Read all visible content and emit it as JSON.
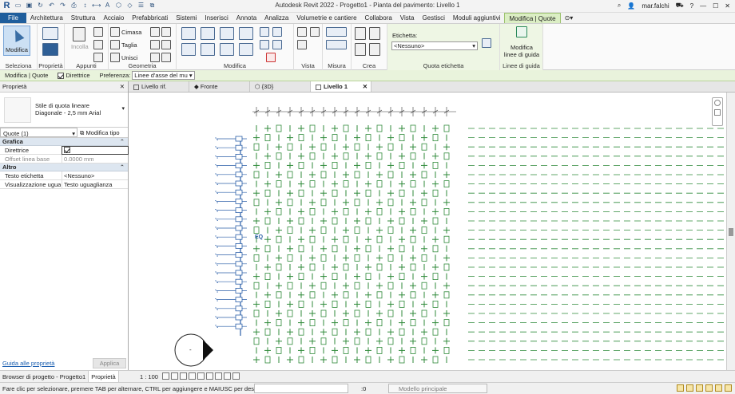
{
  "app": {
    "window_title": "Autodesk Revit 2022 - Progetto1 - Pianta del pavimento: Livello 1",
    "logo": "R",
    "user": "mar.falchi"
  },
  "menu": {
    "tabs": [
      "File",
      "Architettura",
      "Struttura",
      "Acciaio",
      "Prefabbricati",
      "Sistemi",
      "Inserisci",
      "Annota",
      "Analizza",
      "Volumetrie e cantiere",
      "Collabora",
      "Vista",
      "Gestisci",
      "Moduli aggiuntivi",
      "Modifica | Quote"
    ],
    "active": "Modifica | Quote"
  },
  "ribbon": {
    "modifica_label": "Modifica",
    "incolla_label": "Incolla",
    "cimasa_label": "Cimasa",
    "taglia_label": "Taglia",
    "unisci_label": "Unisci",
    "etichetta_label": "Etichetta:",
    "etichetta_value": "<Nessuno>",
    "modifica_linee_label_1": "Modifica",
    "modifica_linee_label_2": "linee di guida",
    "panels": {
      "seleziona": "Seleziona",
      "proprieta": "Proprietà",
      "appunti": "Appunti",
      "geometria": "Geometria",
      "modifica": "Modifica",
      "vista": "Vista",
      "misura": "Misura",
      "crea": "Crea",
      "quota_etichetta": "Quota etichetta",
      "linee_guida": "Linee di guida"
    }
  },
  "options_bar": {
    "context": "Modifica | Quote",
    "direttrice_label": "Direttrice",
    "direttrice_checked": true,
    "preferenza_label": "Preferenza:",
    "preferenza_value": "Linee d'asse del mu"
  },
  "properties": {
    "header": "Proprietà",
    "type_line1": "Stile di quota lineare",
    "type_line2": "Diagonale - 2,5 mm Arial",
    "instance_filter": "Quote (1)",
    "modify_type": "Modifica tipo",
    "groups": [
      {
        "name": "Grafica",
        "rows": [
          {
            "k": "Direttrice",
            "v": "",
            "check": true
          },
          {
            "k": "Offset linea base",
            "v": "0.0000 mm",
            "dim": true
          }
        ]
      },
      {
        "name": "Altro",
        "rows": [
          {
            "k": "Testo etichetta",
            "v": "<Nessuno>"
          },
          {
            "k": "Visualizzazione ugua...",
            "v": "Testo uguaglianza"
          }
        ]
      }
    ],
    "help_link": "Guida alle proprietà",
    "apply": "Applica"
  },
  "bottom_tabs": [
    "Browser di progetto - Progetto1",
    "Proprietà"
  ],
  "view_tabs": [
    {
      "label": "Livello rif.",
      "active": false
    },
    {
      "label": "Fronte",
      "active": false
    },
    {
      "label": "{3D}",
      "active": false
    },
    {
      "label": "Livello 1",
      "active": true
    }
  ],
  "canvas": {
    "eq_label": "EQ",
    "dim_label": "-"
  },
  "view_control": {
    "scale": "1 : 100"
  },
  "status": {
    "message": "Fare clic per selezionare, premere TAB per alternare, CTRL per aggiungere e MAIUSC per desel",
    "zero": ":0",
    "model": "Modello principale"
  }
}
